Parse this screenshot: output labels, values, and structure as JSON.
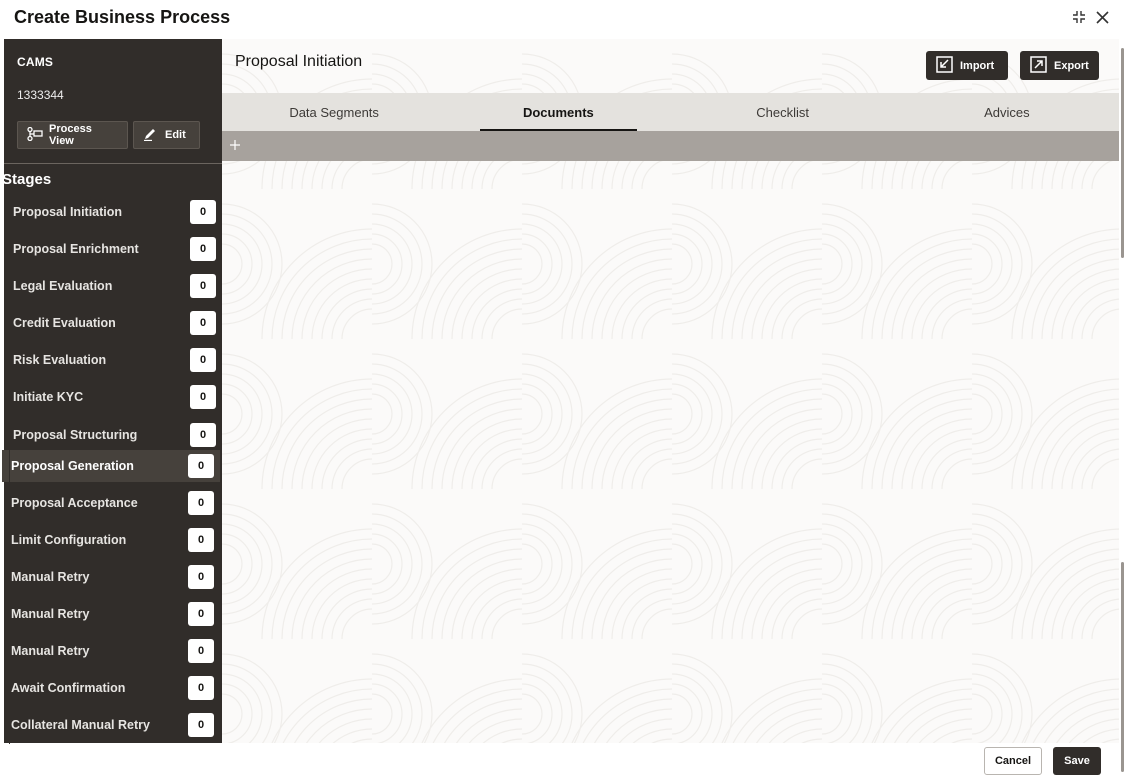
{
  "window": {
    "title": "Create Business Process"
  },
  "sidebar": {
    "org": "CAMS",
    "id": "1333344",
    "process_view_label": "Process View",
    "edit_label": "Edit",
    "stages_title": "Stages",
    "stages": [
      {
        "label": "Proposal Initiation",
        "count": "0"
      },
      {
        "label": "Proposal Enrichment",
        "count": "0"
      },
      {
        "label": "Legal Evaluation",
        "count": "0"
      },
      {
        "label": "Credit Evaluation",
        "count": "0"
      },
      {
        "label": "Risk Evaluation",
        "count": "0"
      },
      {
        "label": "Initiate KYC",
        "count": "0"
      },
      {
        "label": "Proposal Structuring",
        "count": "0"
      },
      {
        "label": "Proposal Generation",
        "count": "0",
        "active": true
      },
      {
        "label": "Proposal Acceptance",
        "count": "0"
      },
      {
        "label": "Limit Configuration",
        "count": "0"
      },
      {
        "label": "Manual Retry",
        "count": "0"
      },
      {
        "label": "Manual Retry",
        "count": "0"
      },
      {
        "label": "Manual Retry",
        "count": "0"
      },
      {
        "label": "Await Confirmation",
        "count": "0"
      },
      {
        "label": "Collateral Manual Retry",
        "count": "0"
      }
    ]
  },
  "main": {
    "title": "Proposal Initiation",
    "import_label": "Import",
    "export_label": "Export",
    "tabs": [
      {
        "label": "Data Segments"
      },
      {
        "label": "Documents",
        "active": true
      },
      {
        "label": "Checklist"
      },
      {
        "label": "Advices"
      }
    ]
  },
  "footer": {
    "cancel_label": "Cancel",
    "save_label": "Save"
  },
  "icons": {
    "minimize": "compress-icon",
    "close": "close-icon",
    "process_view": "process-flow-icon",
    "edit": "pencil-icon",
    "import": "import-icon",
    "export": "export-icon",
    "add": "plus-icon"
  },
  "colors": {
    "sidebar_bg": "#312d2a",
    "active_stage_bg": "#46413c",
    "tabs_bg": "#e4e2de",
    "toolbar_strip": "#a7a29d",
    "primary_button": "#312d2a"
  }
}
